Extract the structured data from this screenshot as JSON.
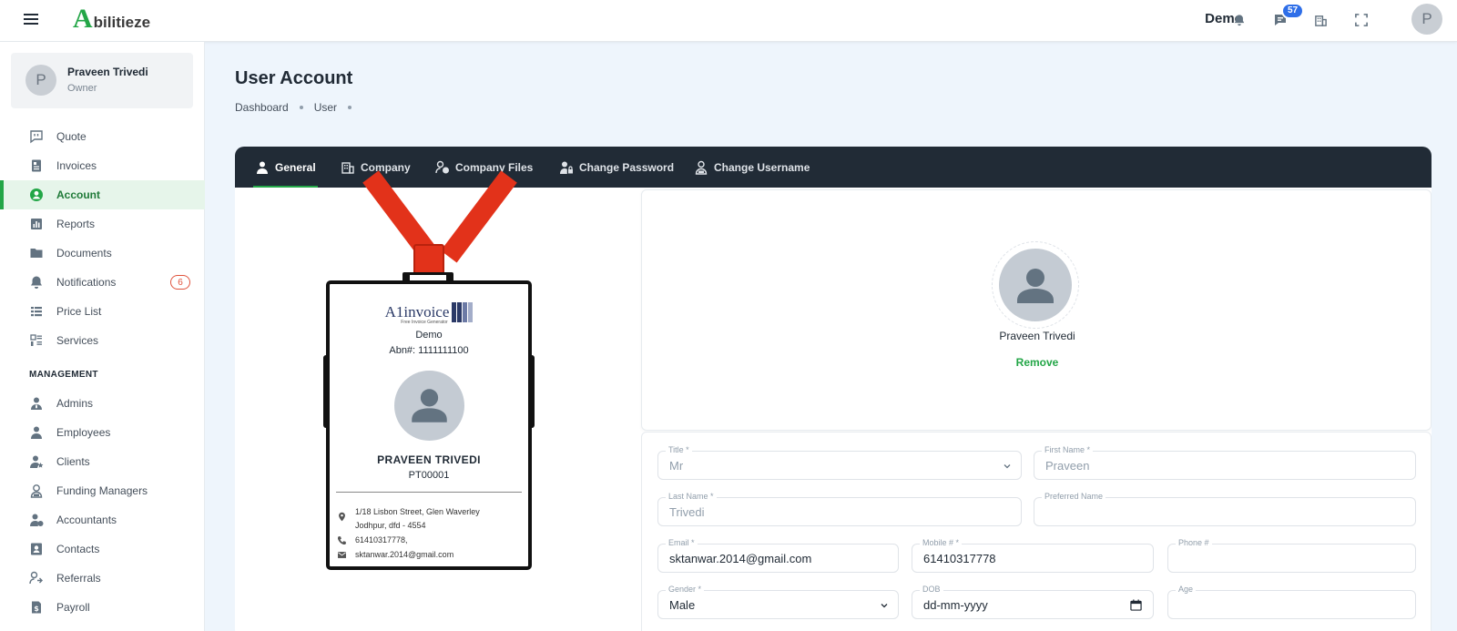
{
  "topbar": {
    "logo_initial": "A",
    "logo_rest": "bilitieze",
    "company": "Demo",
    "messages_count": "57",
    "avatar_initial": "P"
  },
  "sidebar": {
    "user": {
      "initial": "P",
      "name": "Praveen Trivedi",
      "role": "Owner"
    },
    "items": [
      {
        "label": "Quote",
        "icon": "quote-icon"
      },
      {
        "label": "Invoices",
        "icon": "invoice-icon"
      },
      {
        "label": "Account",
        "icon": "account-icon",
        "active": true
      },
      {
        "label": "Reports",
        "icon": "reports-icon"
      },
      {
        "label": "Documents",
        "icon": "folder-icon"
      },
      {
        "label": "Notifications",
        "icon": "bell-icon",
        "badge": "6"
      },
      {
        "label": "Price List",
        "icon": "list-icon"
      },
      {
        "label": "Services",
        "icon": "services-icon"
      }
    ],
    "management_title": "MANAGEMENT",
    "management_items": [
      {
        "label": "Admins",
        "icon": "admin-icon"
      },
      {
        "label": "Employees",
        "icon": "employee-icon"
      },
      {
        "label": "Clients",
        "icon": "client-icon"
      },
      {
        "label": "Funding Managers",
        "icon": "funding-manager-icon"
      },
      {
        "label": "Accountants",
        "icon": "accountant-icon"
      },
      {
        "label": "Contacts",
        "icon": "contacts-icon"
      },
      {
        "label": "Referrals",
        "icon": "referrals-icon"
      },
      {
        "label": "Payroll",
        "icon": "payroll-icon"
      }
    ]
  },
  "page": {
    "title": "User Account",
    "breadcrumb": [
      "Dashboard",
      "User"
    ]
  },
  "tabs": [
    {
      "label": "General",
      "active": true
    },
    {
      "label": "Company"
    },
    {
      "label": "Company Files"
    },
    {
      "label": "Change Password"
    },
    {
      "label": "Change Username"
    }
  ],
  "id_card": {
    "logo_text": "A1invoice",
    "logo_sub": "Free Invoice Generator",
    "company": "Demo",
    "abn": "Abn#: 1111111100",
    "name": "PRAVEEN TRIVEDI",
    "code": "PT00001",
    "address_line1": "1/18 Lisbon Street, Glen Waverley",
    "address_line2": "Jodhpur, dfd - 4554",
    "phone": "61410317778,",
    "email": "sktanwar.2014@gmail.com"
  },
  "profile": {
    "name": "Praveen Trivedi",
    "remove_label": "Remove"
  },
  "form": {
    "title": {
      "label": "Title *",
      "value": "Mr"
    },
    "first_name": {
      "label": "First Name *",
      "value": "Praveen"
    },
    "last_name": {
      "label": "Last Name *",
      "value": "Trivedi"
    },
    "preferred_name": {
      "label": "Preferred Name",
      "value": ""
    },
    "email": {
      "label": "Email *",
      "value": "sktanwar.2014@gmail.com"
    },
    "mobile": {
      "label": "Mobile # *",
      "value": "61410317778"
    },
    "phone": {
      "label": "Phone #",
      "value": ""
    },
    "gender": {
      "label": "Gender *",
      "value": "Male"
    },
    "dob": {
      "label": "DOB",
      "value": "dd-mm-yyyy"
    },
    "age": {
      "label": "Age",
      "value": ""
    }
  },
  "colors": {
    "brand_green": "#23a647",
    "tabbar": "#212b36",
    "strap_red": "#e2321a",
    "badge_blue": "#2e6ee8"
  }
}
